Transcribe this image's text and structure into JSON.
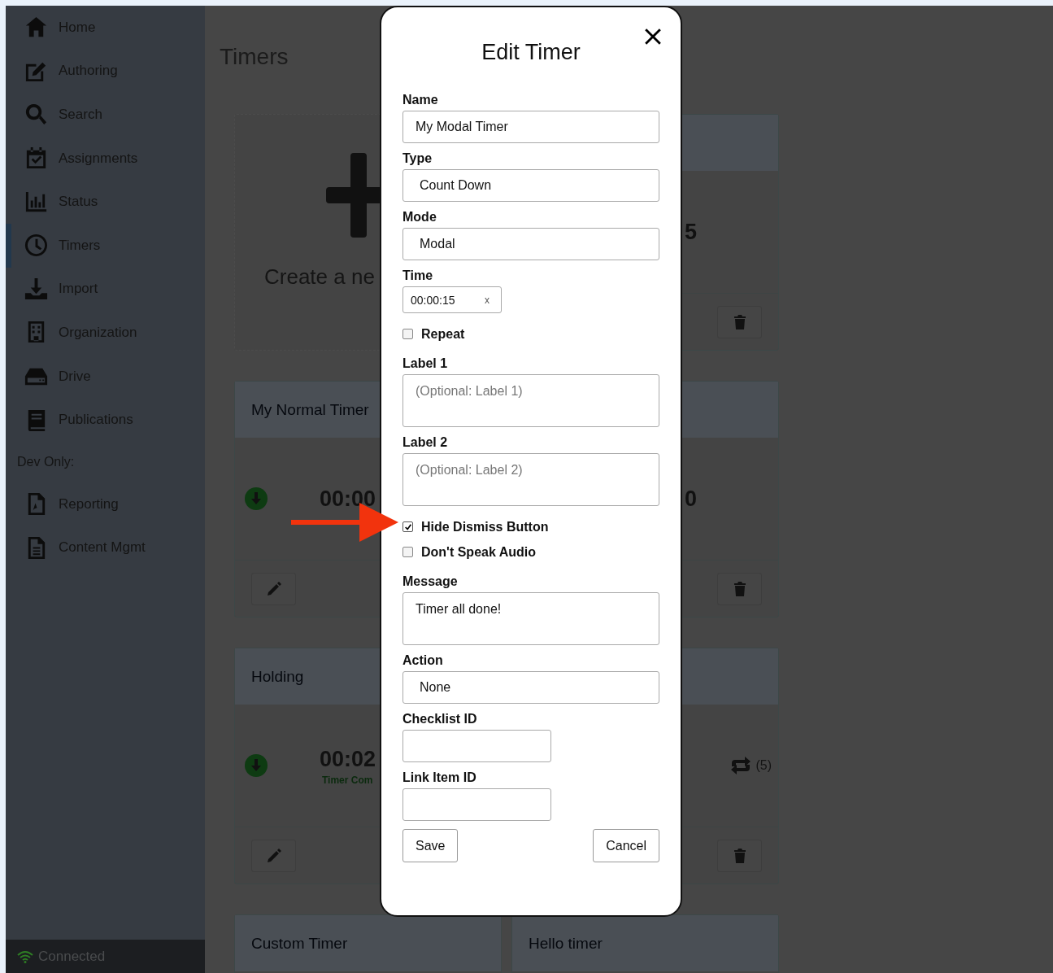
{
  "sidebar": {
    "items": [
      {
        "label": "Home",
        "selected": false
      },
      {
        "label": "Authoring",
        "selected": false
      },
      {
        "label": "Search",
        "selected": false
      },
      {
        "label": "Assignments",
        "selected": false
      },
      {
        "label": "Status",
        "selected": false
      },
      {
        "label": "Timers",
        "selected": true
      },
      {
        "label": "Import",
        "selected": false
      },
      {
        "label": "Organization",
        "selected": false
      },
      {
        "label": "Drive",
        "selected": false
      },
      {
        "label": "Publications",
        "selected": false
      }
    ],
    "dev_section": {
      "label": "Dev Only:",
      "items": [
        {
          "label": "Reporting",
          "selected": false
        },
        {
          "label": "Content Mgmt",
          "selected": false
        }
      ]
    },
    "status": "Connected"
  },
  "main": {
    "title": "Timers",
    "cards": [
      {
        "kind": "create",
        "label": "Create a ne"
      },
      {
        "kind": "right",
        "time": "5"
      },
      {
        "kind": "left",
        "title": "My Normal Timer",
        "time": "00:00"
      },
      {
        "kind": "right",
        "time": "0"
      },
      {
        "kind": "left",
        "title": "Holding",
        "time": "00:02",
        "subtitle": "Timer Com"
      },
      {
        "kind": "right",
        "repeat_count": "(5)"
      },
      {
        "kind": "stub",
        "title": "Custom Timer"
      },
      {
        "kind": "stub",
        "title": "Hello timer"
      }
    ]
  },
  "modal": {
    "title": "Edit Timer",
    "fields": [
      {
        "kind": "input",
        "label": "Name",
        "value": "My Modal Timer"
      },
      {
        "kind": "select",
        "label": "Type",
        "value": "Count Down"
      },
      {
        "kind": "select",
        "label": "Mode",
        "value": "Modal"
      },
      {
        "kind": "time",
        "label": "Time",
        "value": "00:00:15",
        "clear": "x"
      },
      {
        "kind": "checkbox",
        "label": "Repeat",
        "checked": false
      },
      {
        "kind": "textarea",
        "label": "Label 1",
        "placeholder": "(Optional: Label 1)"
      },
      {
        "kind": "textarea",
        "label": "Label 2",
        "placeholder": "(Optional: Label 2)"
      },
      {
        "kind": "checkbox",
        "label": "Hide Dismiss Button",
        "checked": true
      },
      {
        "kind": "checkbox",
        "label": "Don't Speak Audio",
        "checked": false
      },
      {
        "kind": "textarea",
        "label": "Message",
        "value": "Timer all done!"
      },
      {
        "kind": "select",
        "label": "Action",
        "value": "None"
      },
      {
        "kind": "short",
        "label": "Checklist ID"
      },
      {
        "kind": "short",
        "label": "Link Item ID"
      }
    ],
    "buttons": [
      {
        "label": "Save"
      },
      {
        "label": "Cancel"
      }
    ]
  }
}
